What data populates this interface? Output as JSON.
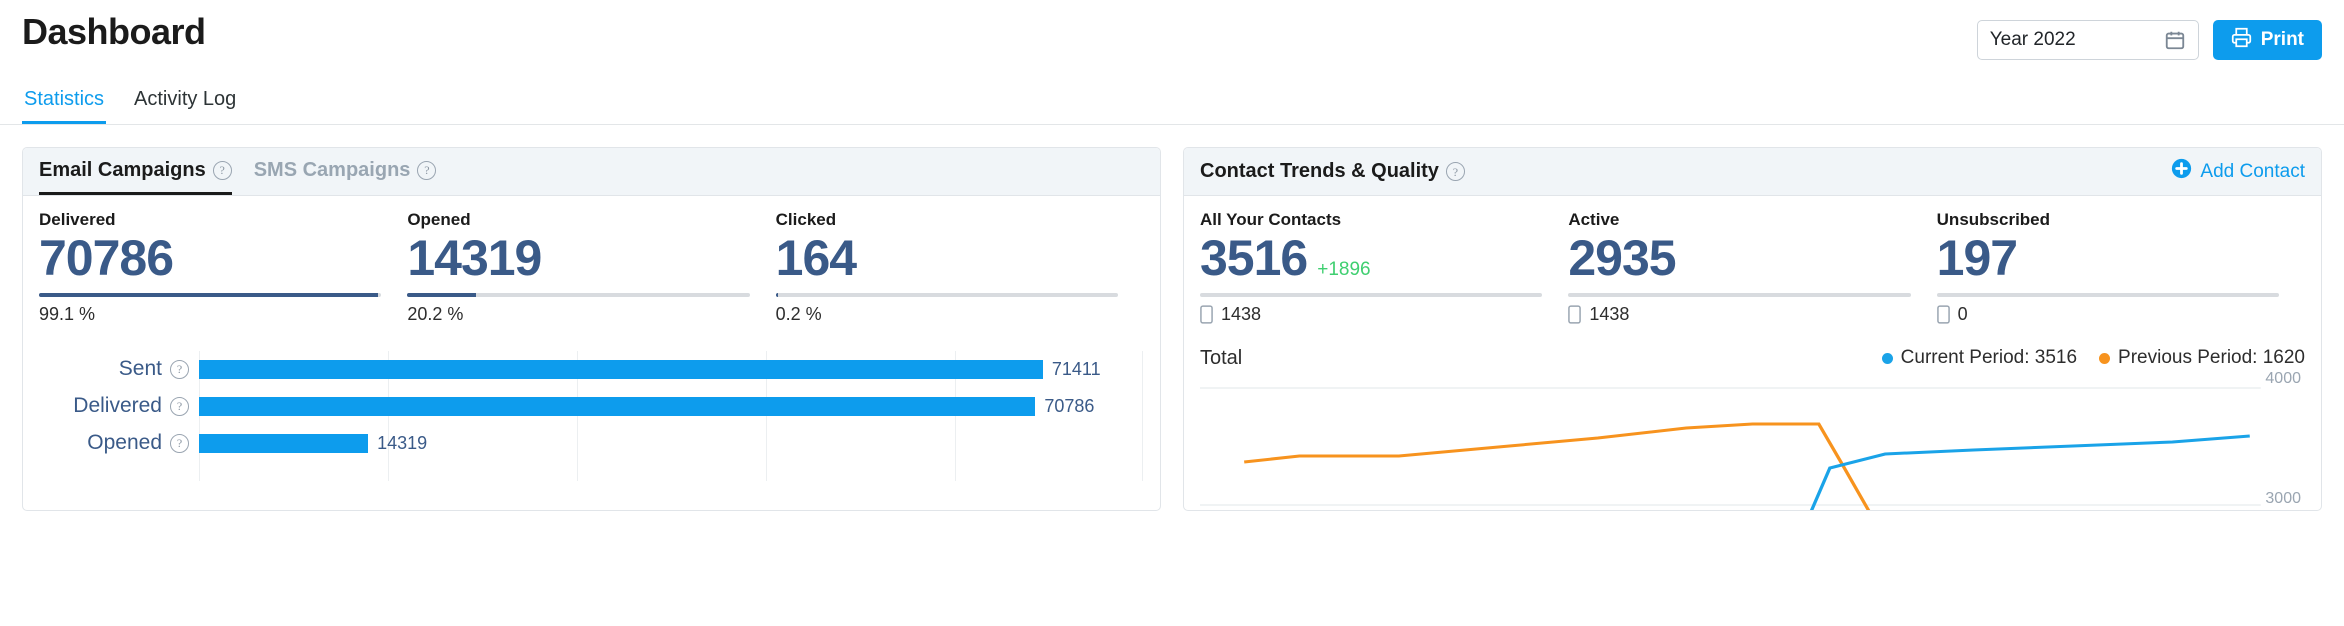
{
  "header": {
    "title": "Dashboard",
    "date_picker": {
      "value": "Year 2022",
      "icon": "calendar-icon"
    },
    "print_button": {
      "label": "Print",
      "icon": "printer-icon",
      "color": "#0d9ced"
    }
  },
  "nav_tabs": [
    {
      "label": "Statistics",
      "active": true
    },
    {
      "label": "Activity Log",
      "active": false
    }
  ],
  "email_card": {
    "tabs": [
      {
        "label": "Email Campaigns",
        "active": true,
        "help": "?"
      },
      {
        "label": "SMS Campaigns",
        "active": false,
        "help": "?"
      }
    ],
    "kpis": [
      {
        "label": "Delivered",
        "value": "70786",
        "percent_label": "99.1 %",
        "percent": 99.1
      },
      {
        "label": "Opened",
        "value": "14319",
        "percent_label": "20.2 %",
        "percent": 20.2
      },
      {
        "label": "Clicked",
        "value": "164",
        "percent_label": "0.2 %",
        "percent": 0.2
      }
    ],
    "chart_data": {
      "type": "bar",
      "orientation": "horizontal",
      "categories": [
        "Sent",
        "Delivered",
        "Opened"
      ],
      "values": [
        71411,
        70786,
        14319
      ],
      "value_labels": [
        "71411",
        "70786",
        "14319"
      ],
      "title": "",
      "xlabel": "",
      "ylabel": "",
      "xlim": [
        0,
        80000
      ],
      "grid": true,
      "bar_color": "#0d9ced",
      "label_color": "#3a5a88"
    }
  },
  "contacts_card": {
    "title": "Contact Trends & Quality",
    "help": "?",
    "add_contact": {
      "label": "Add Contact",
      "icon": "plus-circle-icon",
      "color": "#0d9ced"
    },
    "kpis": [
      {
        "label": "All Your Contacts",
        "value": "3516",
        "delta": "+1896",
        "sub_value": "1438",
        "sub_icon": "mobile-icon"
      },
      {
        "label": "Active",
        "value": "2935",
        "delta": "",
        "sub_value": "1438",
        "sub_icon": "mobile-icon"
      },
      {
        "label": "Unsubscribed",
        "value": "197",
        "delta": "",
        "sub_value": "0",
        "sub_icon": "mobile-icon"
      }
    ],
    "total_label": "Total",
    "legend": [
      {
        "label": "Current Period: 3516",
        "color": "#1aa3e8"
      },
      {
        "label": "Previous Period: 1620",
        "color": "#f7931e"
      }
    ],
    "chart_data": {
      "type": "line",
      "title": "",
      "xlabel": "",
      "ylabel": "",
      "ylim": [
        3000,
        4000
      ],
      "y_ticks": [
        "4000",
        "3000"
      ],
      "grid": true,
      "series": [
        {
          "name": "Previous Period",
          "color": "#f7931e",
          "x": [
            0,
            8,
            16,
            24,
            32,
            40,
            48,
            56,
            58,
            64
          ],
          "values": [
            3330,
            3345,
            3345,
            3390,
            3430,
            3490,
            3530,
            3530,
            3330,
            2990
          ]
        },
        {
          "name": "Current Period",
          "color": "#1aa3e8",
          "x": [
            44,
            48,
            56,
            64,
            72,
            80,
            88,
            96
          ],
          "values": [
            2960,
            3310,
            3390,
            3400,
            3420,
            3440,
            3460,
            3490
          ]
        }
      ]
    }
  }
}
